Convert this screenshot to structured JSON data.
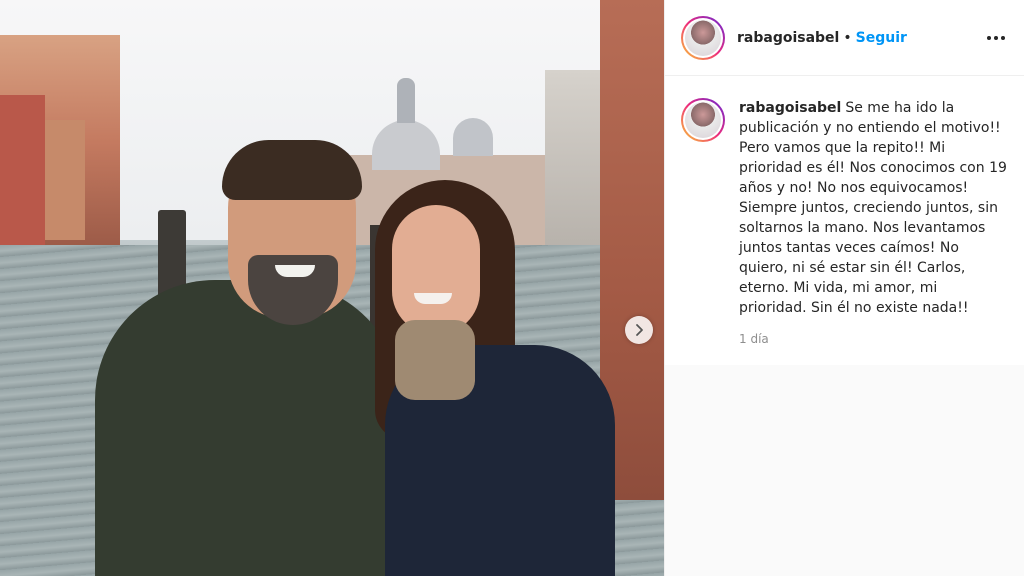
{
  "post": {
    "username": "rabagoisabel",
    "separator": "•",
    "follow_label": "Seguir",
    "more_icon": "more-horizontal-icon",
    "caption": "Se me ha ido la publicación y no entiendo el motivo!! Pero vamos que la repito!! Mi prioridad es él! Nos conocimos con 19 años y no! No nos equivocamos! Siempre juntos, creciendo juntos, sin soltarnos la mano. Nos levantamos juntos tantas veces caímos! No quiero, ni sé estar sin él! Carlos, eterno. Mi vida, mi amor, mi prioridad. Sin él no existe nada!!",
    "time": "1 día"
  },
  "photo": {
    "next_icon": "chevron-right-icon"
  },
  "colors": {
    "accent": "#0095f6",
    "text": "#262626",
    "muted": "#8e8e8e"
  }
}
